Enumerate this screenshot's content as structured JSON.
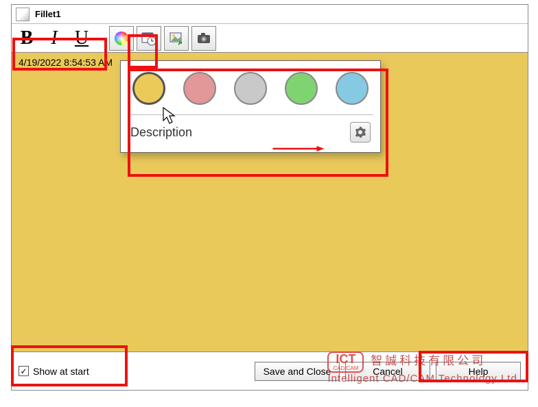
{
  "title": "Fillet1",
  "toolbar": {
    "bold": "B",
    "italic": "I",
    "underline": "U"
  },
  "note": {
    "timestamp": "4/19/2022 8:54:53 AM"
  },
  "colorPopup": {
    "descriptionLabel": "Description",
    "swatches": [
      {
        "name": "yellow",
        "hex": "#ecca59",
        "selected": true
      },
      {
        "name": "pink",
        "hex": "#e29798",
        "selected": false
      },
      {
        "name": "gray",
        "hex": "#c9c9c9",
        "selected": false
      },
      {
        "name": "green",
        "hex": "#7fd471",
        "selected": false
      },
      {
        "name": "blue",
        "hex": "#86c9e3",
        "selected": false
      }
    ]
  },
  "footer": {
    "showAtStartLabel": "Show at start",
    "showAtStartChecked": true,
    "saveClose": "Save and Close",
    "cancel": "Cancel",
    "help": "Help"
  },
  "watermark": {
    "logoTop": "ICT",
    "logoSub": "CAD/CAM",
    "line1": "智誠科技有限公司",
    "line2": "Intelligent CAD/CAM Technology Ltd."
  }
}
